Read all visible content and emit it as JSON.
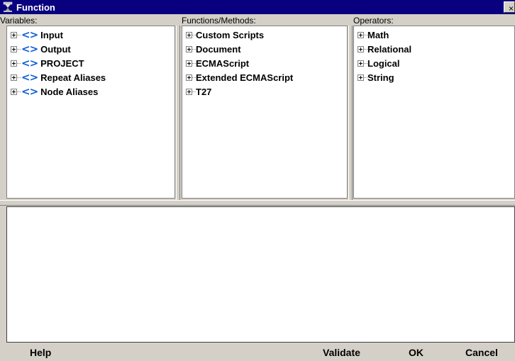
{
  "window": {
    "title": "Function",
    "close_label": "×",
    "app_icon": "function-icon",
    "title_bar_color": "#08007e"
  },
  "panes": {
    "variables": {
      "label": "Variables:",
      "items": [
        {
          "label": "Input",
          "icon": "variable-icon"
        },
        {
          "label": "Output",
          "icon": "variable-icon"
        },
        {
          "label": "PROJECT",
          "icon": "variable-icon"
        },
        {
          "label": "Repeat Aliases",
          "icon": "variable-icon"
        },
        {
          "label": "Node Aliases",
          "icon": "variable-icon"
        }
      ]
    },
    "functions": {
      "label": "Functions/Methods:",
      "items": [
        {
          "label": "Custom Scripts"
        },
        {
          "label": "Document"
        },
        {
          "label": "ECMAScript"
        },
        {
          "label": "Extended ECMAScript"
        },
        {
          "label": "T27"
        }
      ]
    },
    "operators": {
      "label": "Operators:",
      "items": [
        {
          "label": "Math"
        },
        {
          "label": "Relational"
        },
        {
          "label": "Logical"
        },
        {
          "label": "String"
        }
      ]
    }
  },
  "editor": {
    "value": ""
  },
  "buttons": {
    "help": "Help",
    "validate": "Validate",
    "ok": "OK",
    "cancel": "Cancel"
  },
  "icons": {
    "variable_glyph": "<>"
  }
}
